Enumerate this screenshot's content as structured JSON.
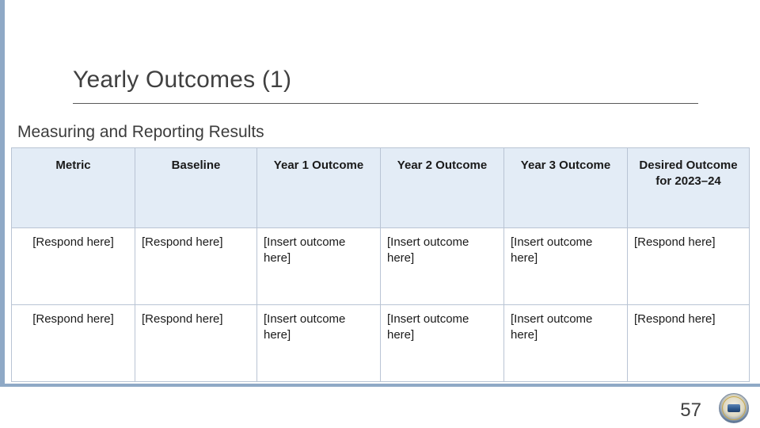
{
  "slide": {
    "title": "Yearly Outcomes (1)",
    "subtitle": "Measuring and Reporting Results",
    "page_number": "57",
    "logo_name": "organization-seal",
    "accent_color": "#8fa9c6",
    "header_fill": "#e3ecf6",
    "border_color": "#b9c4d4"
  },
  "table": {
    "headers": [
      "Metric",
      "Baseline",
      "Year 1 Outcome",
      "Year 2 Outcome",
      "Year 3 Outcome",
      "Desired Outcome for 2023–24"
    ],
    "rows": [
      {
        "metric": "[Respond here]",
        "baseline": "[Respond here]",
        "year1": "[Insert outcome here]",
        "year2": "[Insert outcome here]",
        "year3": "[Insert outcome here]",
        "desired": "[Respond here]"
      },
      {
        "metric": "[Respond here]",
        "baseline": "[Respond here]",
        "year1": "[Insert outcome here]",
        "year2": "[Insert outcome here]",
        "year3": "[Insert outcome here]",
        "desired": "[Respond here]"
      }
    ]
  }
}
